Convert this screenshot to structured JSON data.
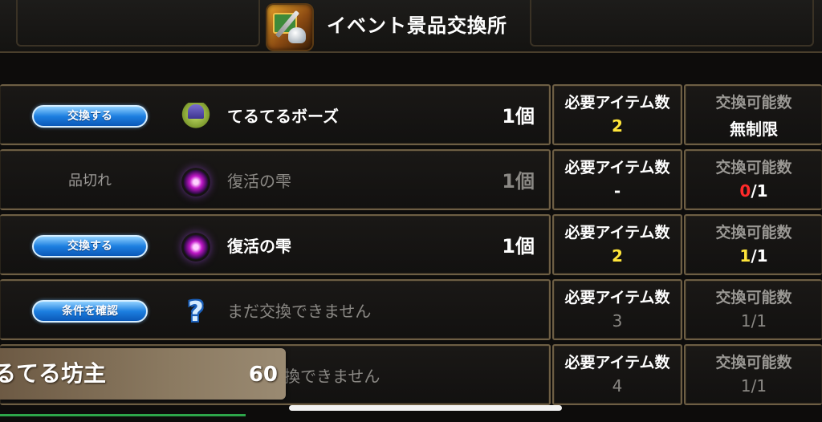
{
  "header": {
    "title": "イベント景品交換所",
    "icon": "event-shop-icon"
  },
  "rows": [
    {
      "action": "交換する",
      "action_type": "button",
      "item_icon": "teru-teru-bozu-icon",
      "item_name": "てるてるボーズ",
      "quantity": "1個",
      "req_label": "必要アイテム数",
      "req_value": "2",
      "avail_label": "交換可能数",
      "avail_value": "無制限"
    },
    {
      "action": "品切れ",
      "action_type": "label",
      "item_icon": "revival-drop-icon",
      "item_name": "復活の雫",
      "quantity": "1個",
      "req_label": "必要アイテム数",
      "req_value": "-",
      "avail_label": "交換可能数",
      "avail_used": "0",
      "avail_total": "/1"
    },
    {
      "action": "交換する",
      "action_type": "button",
      "item_icon": "revival-drop-icon",
      "item_name": "復活の雫",
      "quantity": "1個",
      "req_label": "必要アイテム数",
      "req_value": "2",
      "avail_label": "交換可能数",
      "avail_used": "1",
      "avail_total": "/1"
    },
    {
      "action": "条件を確認",
      "action_type": "button",
      "item_icon": "question-mark-icon",
      "item_name": "まだ交換できません",
      "quantity": "",
      "req_label": "必要アイテム数",
      "req_value": "3",
      "avail_label": "交換可能数",
      "avail_value": "1/1"
    },
    {
      "item_name": "換できません",
      "req_label": "必要アイテム数",
      "req_value": "4",
      "avail_label": "交換可能数",
      "avail_value": "1/1"
    }
  ],
  "popup": {
    "name": "るてる坊主",
    "count": "60"
  },
  "colors": {
    "highlight": "#ffe53a",
    "warning": "#ff2a2a",
    "button": "#1d7fe0"
  }
}
